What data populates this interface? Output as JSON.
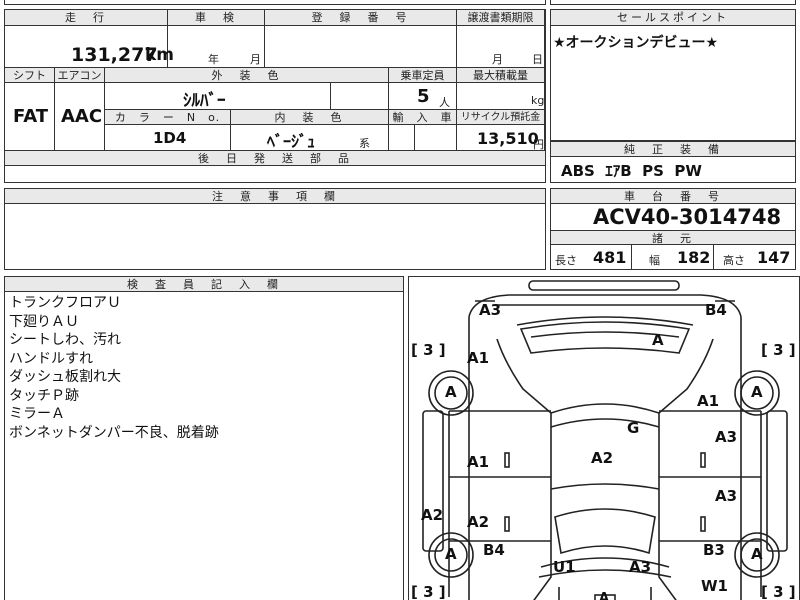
{
  "top_row": {
    "mileage_header": "走　行",
    "inspection_header": "車　検",
    "registration_header": "登　録　番　号",
    "transfer_header": "譲渡書類期限",
    "sales_point_header": "セールスポイント",
    "mileage_value": "131,277",
    "mileage_unit": "km",
    "year_unit": "年",
    "month_unit": "月",
    "transfer_month": "月",
    "transfer_day": "日",
    "sales_point_text": "★オークションデビュー★"
  },
  "second_row": {
    "shift_header": "シフト",
    "aircon_header": "エアコン",
    "exterior_header": "外　装　色",
    "capacity_header": "乗車定員",
    "load_header": "最大積載量",
    "shift_value": "FAT",
    "aircon_value": "AAC",
    "exterior_value": "ｼﾙﾊﾞｰ",
    "capacity_value": "5",
    "capacity_unit": "人",
    "load_unit": "kg",
    "color_no_header": "カ　ラ　ー　N　o.",
    "interior_header": "内　装　色",
    "import_header": "輸　入　車",
    "recycle_header": "リサイクル預託金",
    "color_no_value": "1D4",
    "interior_value": "ﾍﾞｰｼﾞｭ",
    "interior_suffix": "系",
    "recycle_value": "13,510",
    "recycle_unit": "円",
    "shipping_header": "後　日　発　送　部　品"
  },
  "equipment": {
    "header": "純　正　装　備",
    "value": "ABS  ｴｱB  PS  PW"
  },
  "notes": {
    "header": "注　意　事　項　欄"
  },
  "chassis": {
    "header": "車　台　番　号",
    "value": "ACV40-3014748",
    "spec_header": "諸　元",
    "length_label": "長さ",
    "length_value": "481",
    "width_label": "幅",
    "width_value": "182",
    "height_label": "高さ",
    "height_value": "147"
  },
  "inspector": {
    "header": "検　査　員　記　入　欄",
    "lines": [
      "トランクフロアＵ",
      "下廻りＡＵ",
      "シートしわ、汚れ",
      "ハンドルすれ",
      "ダッシュ板割れ大",
      "タッチＰ跡",
      "ミラーＡ",
      "ボンネットダンパー不良、脱着跡"
    ]
  },
  "diagram": {
    "labels": {
      "a3_top_left": "A3",
      "b4_top_right": "B4",
      "a_rear_glass": "A",
      "a1_left_upper": "A1",
      "a1_right_upper": "A1",
      "g_roof": "G",
      "a3_right_rear_door": "A3",
      "a2_roof": "A2",
      "a1_left_rear_door": "A1",
      "a3_right_front_door": "A3",
      "a2_left_edge": "A2",
      "a2_left_front_door": "A2",
      "b4_left_lower": "B4",
      "b3_right_lower": "B3",
      "u1_front": "U1",
      "a3_front": "A3",
      "w1_right": "W1",
      "tire_rl": "A",
      "tire_rr": "A",
      "tire_fl": "A",
      "tire_fr": "A",
      "tread_left_top": "[ 3 ]",
      "tread_right_top": "[ 3 ]",
      "tread_left_bottom": "[ 3 ]",
      "tread_right_bottom": "[ 3 ]",
      "a_bottom": "A"
    }
  }
}
